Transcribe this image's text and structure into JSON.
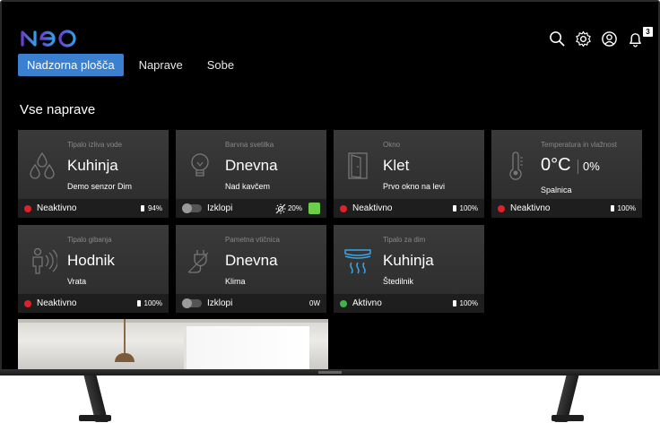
{
  "app": {
    "logo_text": "neo",
    "accent_color": "#3a7fd0",
    "logo_gradient": [
      "#6a3fd0",
      "#2fa0e8"
    ]
  },
  "header": {
    "tabs": [
      {
        "label": "Nadzorna plošča",
        "active": true
      },
      {
        "label": "Naprave",
        "active": false
      },
      {
        "label": "Sobe",
        "active": false
      }
    ],
    "icons": [
      "search-icon",
      "gear-icon",
      "account-icon",
      "bell-icon"
    ],
    "notification_count": "3"
  },
  "main": {
    "section_title": "Vse naprave",
    "devices": [
      {
        "type": "Tipalo izliva vode",
        "name": "Kuhinja",
        "sub": "Demo senzor Dim",
        "status": "Neaktivno",
        "status_color": "#e0202a",
        "battery": "94%",
        "icon": "water-drops-icon"
      },
      {
        "type": "Barvna svetilka",
        "name": "Dnevna",
        "sub": "Nad kavčem",
        "status": "Izklopi",
        "brightness": "20%",
        "color": "#6ccf49",
        "icon": "bulb-icon"
      },
      {
        "type": "Okno",
        "name": "Klet",
        "sub": "Prvo okno na levi",
        "status": "Neaktivno",
        "status_color": "#e0202a",
        "battery": "100%",
        "icon": "door-icon"
      },
      {
        "type": "Temperatura in vlažnost",
        "temperature": "0°C",
        "humidity": "0%",
        "sub": "Spalnica",
        "status": "Neaktivno",
        "status_color": "#e0202a",
        "battery": "100%",
        "icon": "thermometer-icon"
      },
      {
        "type": "Tipalo gibanja",
        "name": "Hodnik",
        "sub": "Vrata",
        "status": "Neaktivno",
        "status_color": "#e0202a",
        "battery": "100%",
        "icon": "motion-person-icon"
      },
      {
        "type": "Pametna vtičnica",
        "name": "Dnevna",
        "sub": "Klima",
        "status": "Izklopi",
        "power": "0W",
        "icon": "plug-icon"
      },
      {
        "type": "Tipalo za dim",
        "name": "Kuhinja",
        "sub": "Štedilnik",
        "status": "Aktivno",
        "status_color": "#3db34a",
        "battery": "100%",
        "icon": "smoke-detector-icon"
      }
    ]
  }
}
